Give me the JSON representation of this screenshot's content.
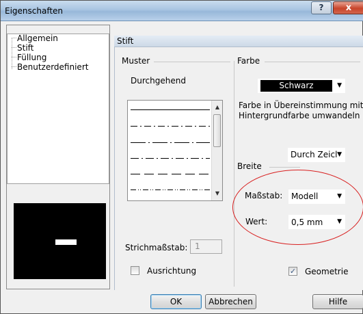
{
  "window": {
    "title": "Eigenschaften"
  },
  "titlebar_buttons": {
    "help": "?",
    "close": "x"
  },
  "tree": {
    "items": [
      "Allgemein",
      "Stift",
      "Füllung",
      "Benutzerdefiniert"
    ]
  },
  "panel": {
    "title": "Stift"
  },
  "muster": {
    "label": "Muster",
    "selected": "Durchgehend",
    "patterns": [
      "solid",
      "dash-dot",
      "long-dash-dot",
      "dash-dot-dash",
      "long-dash",
      "dash-dot-dot",
      "dot"
    ]
  },
  "farbe": {
    "label": "Farbe",
    "color_value": "Schwarz",
    "note_line1": "Farbe in Übereinstimmung mit",
    "note_line2": "Hintergrundfarbe umwandeln",
    "durch": "Durch Zeicl"
  },
  "breite": {
    "label": "Breite",
    "massstab_label": "Maßstab:",
    "massstab_value": "Modell",
    "wert_label": "Wert:",
    "wert_value": "0,5 mm"
  },
  "strich": {
    "label": "Strichmaßstab:",
    "value": "1"
  },
  "checkboxes": {
    "ausrichtung": {
      "label": "Ausrichtung",
      "checked": false
    },
    "geometrie": {
      "label": "Geometrie",
      "checked": true,
      "mark": "✓"
    }
  },
  "buttons": {
    "ok": "OK",
    "cancel": "Abbrechen",
    "help": "Hilfe"
  },
  "colors": {
    "highlight_ellipse": "#d81f1f",
    "title_gradient": "#a9c5e2"
  }
}
